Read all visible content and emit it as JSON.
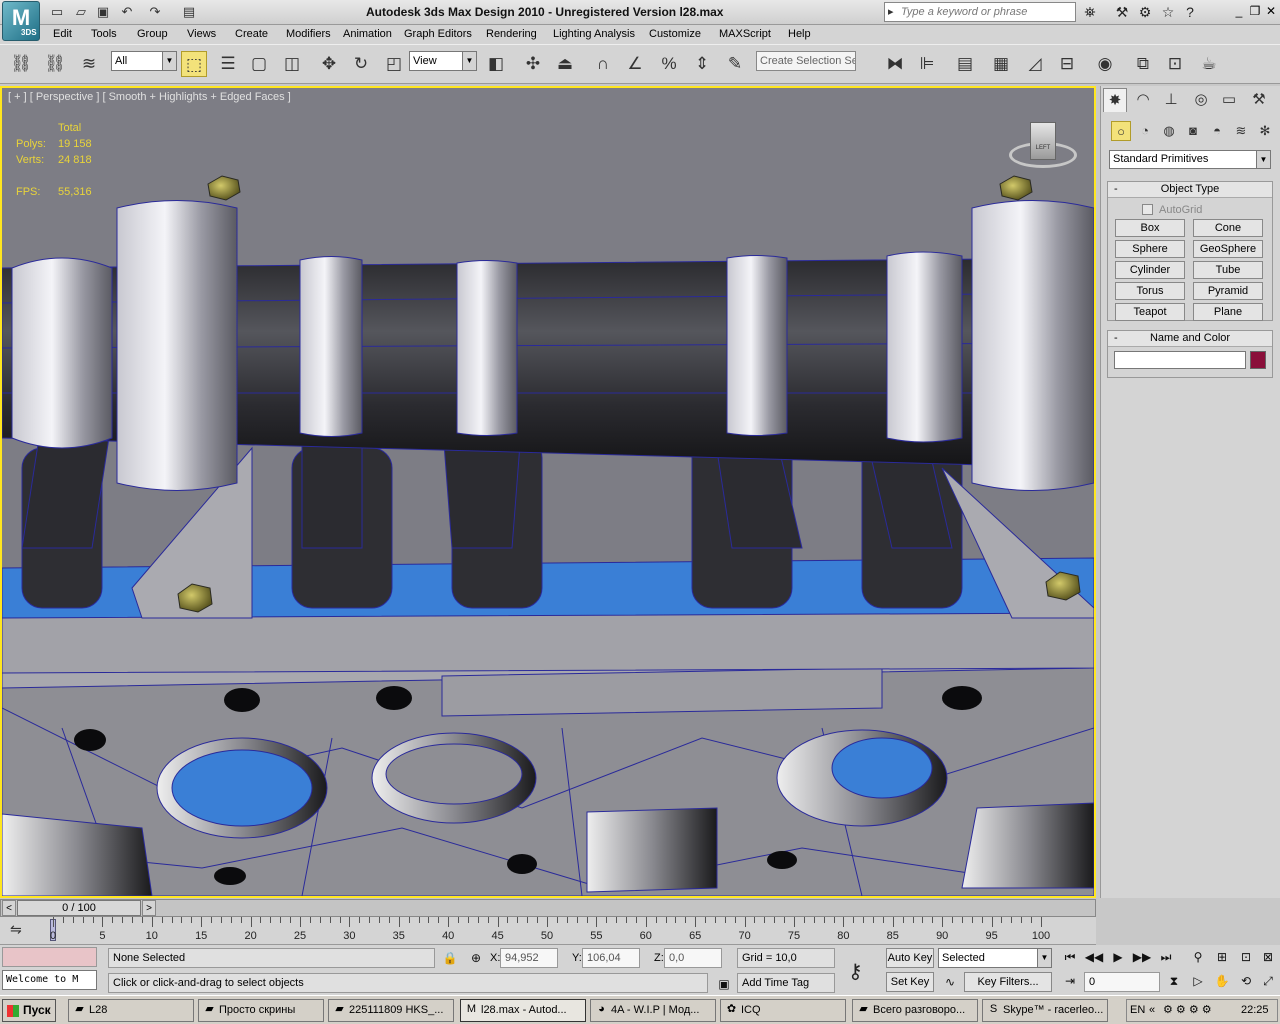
{
  "title_bar": {
    "app_badge": "3DS",
    "title": "Autodesk 3ds Max Design 2010    -  Unregistered Version    l28.max",
    "search_placeholder": "Type a keyword or phrase",
    "icons": [
      "new-file-icon",
      "open-file-icon",
      "save-icon",
      "undo-icon",
      "redo-icon",
      "project-folder-icon",
      "binoculars-icon",
      "connect-icon",
      "favorites-icon",
      "help-icon"
    ]
  },
  "menu": [
    "Edit",
    "Tools",
    "Group",
    "Views",
    "Create",
    "Modifiers",
    "Animation",
    "Graph Editors",
    "Rendering",
    "Lighting Analysis",
    "Customize",
    "MAXScript",
    "Help"
  ],
  "toolbar": {
    "filter_value": "All",
    "refcoord_value": "View",
    "selection_set_placeholder": "Create Selection Se"
  },
  "viewport": {
    "label": "[ + ] [ Perspective ] [ Smooth + Highlights + Edged Faces ]",
    "stats": {
      "header": "Total",
      "polys_label": "Polys:",
      "polys_value": "19 158",
      "verts_label": "Verts:",
      "verts_value": "24 818",
      "fps_label": "FPS:",
      "fps_value": "55,316"
    },
    "viewcube_face": "LEFT"
  },
  "command_panel": {
    "category": "Standard Primitives",
    "object_type": {
      "title": "Object Type",
      "autogrid": "AutoGrid",
      "buttons": [
        "Box",
        "Cone",
        "Sphere",
        "GeoSphere",
        "Cylinder",
        "Tube",
        "Torus",
        "Pyramid",
        "Teapot",
        "Plane"
      ]
    },
    "name_color": {
      "title": "Name and Color",
      "name_value": "",
      "color": "#8a0f3a"
    }
  },
  "time_slider": {
    "frame": "0 / 100"
  },
  "trackbar": {
    "labels": [
      "0",
      "5",
      "10",
      "15",
      "20",
      "25",
      "30",
      "35",
      "40",
      "45",
      "50",
      "55",
      "60",
      "65",
      "70",
      "75",
      "80",
      "85",
      "90",
      "95",
      "100"
    ]
  },
  "status": {
    "welcome": "Welcome to M",
    "selection": "None Selected",
    "prompt": "Click or click-and-drag to select objects",
    "x_label": "X:",
    "x_value": "94,952",
    "y_label": "Y:",
    "y_value": "106,04",
    "z_label": "Z:",
    "z_value": "0,0",
    "grid": "Grid = 10,0",
    "add_time_tag": "Add Time Tag",
    "auto_key": "Auto Key",
    "set_key": "Set Key",
    "key_mode": "Selected",
    "key_filters": "Key Filters...",
    "current_frame": "0"
  },
  "taskbar": {
    "start": "Пуск",
    "tasks": [
      "L28",
      "Просто скрины",
      "225111809 HKS_...",
      "l28.max - Autod...",
      "4A - W.I.P | Мод...",
      "ICQ",
      "Всего разговоро...",
      "Skype™ - racerleo..."
    ],
    "lang": "EN",
    "clock": "22:25"
  },
  "colors": {
    "viewport_bg": "#7d7d85",
    "active_viewport_border": "#ffe61f",
    "stats_text": "#e9d43a",
    "wire": "#2a2a9a",
    "blue_floor": "#3a7fd6"
  }
}
